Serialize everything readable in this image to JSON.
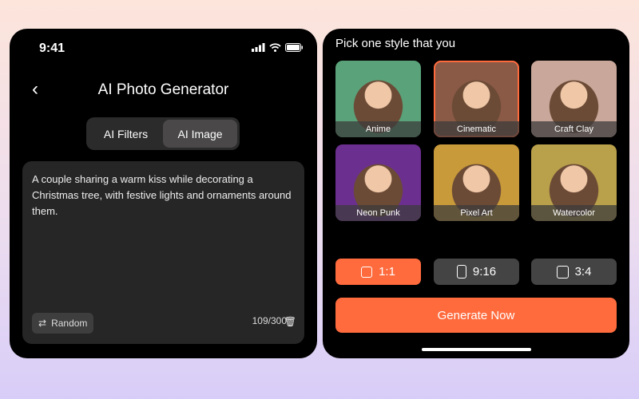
{
  "status": {
    "time": "9:41"
  },
  "left": {
    "title": "AI Photo Generator",
    "tabs": [
      {
        "label": "AI Filters"
      },
      {
        "label": "AI Image"
      }
    ],
    "prompt": "A couple sharing a warm kiss while decorating a Christmas tree, with festive lights and ornaments around them.",
    "random_label": "Random",
    "count": "109/300"
  },
  "right": {
    "heading": "Pick one style that you",
    "styles": [
      {
        "label": "Anime",
        "color": "#5aa37a"
      },
      {
        "label": "Cinematic",
        "color": "#8a5a46"
      },
      {
        "label": "Craft Clay",
        "color": "#c9a79a"
      },
      {
        "label": "Neon Punk",
        "color": "#6b2f8f"
      },
      {
        "label": "Pixel Art",
        "color": "#c99a3a"
      },
      {
        "label": "Watercolor",
        "color": "#b9a04a"
      }
    ],
    "selected_style": "Cinematic",
    "ratios": [
      {
        "label": "1:1"
      },
      {
        "label": "9:16"
      },
      {
        "label": "3:4"
      }
    ],
    "generate_label": "Generate Now"
  },
  "colors": {
    "accent": "#ff6b3d"
  }
}
